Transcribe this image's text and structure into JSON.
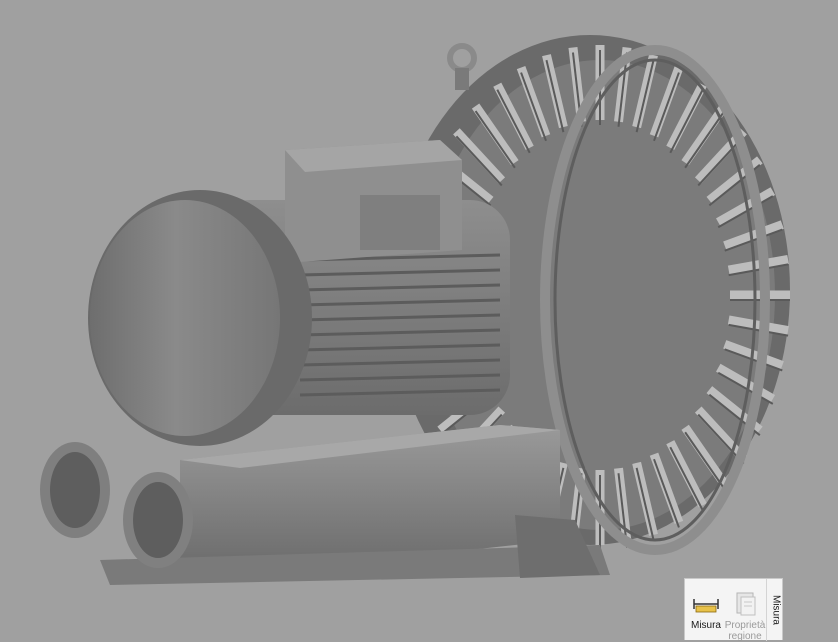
{
  "ribbon": {
    "measure_button_label": "Misura",
    "region_properties_label_line1": "Proprietà",
    "region_properties_label_line2": "regione",
    "group_label": "Misura",
    "icons": {
      "measure": "ruler-measure-icon",
      "region_properties": "region-properties-icon"
    }
  },
  "viewport": {
    "background_color": "#a0a0a0",
    "model": "side-channel-blower-3d-model"
  }
}
